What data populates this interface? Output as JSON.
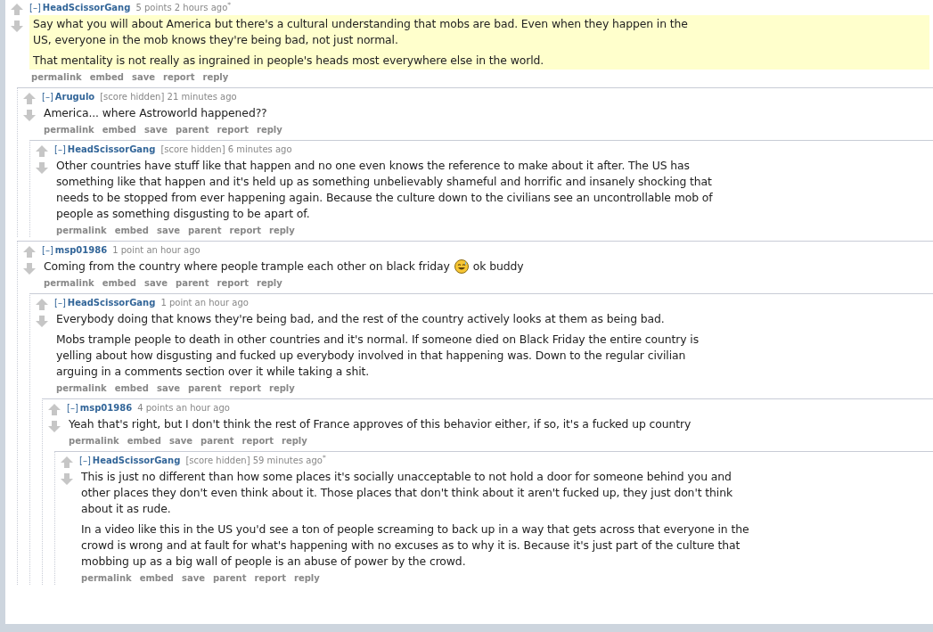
{
  "comments": [
    {
      "collapse": "[–]",
      "author": "HeadScissorGang",
      "score": "5 points",
      "time": "2 hours ago$^{*}$",
      "highlighted": true,
      "body": [
        {
          "kind": "text",
          "text": "Say what you will about America but there's a cultural understanding that mobs are bad.  Even when they happen in the US, everyone in the mob knows they're being bad, not just normal."
        },
        {
          "kind": "text",
          "text": "That mentality is not really as ingrained in people's heads most everywhere else in the world."
        }
      ],
      "buttons": [
        "permalink",
        "embed",
        "save",
        "report",
        "reply"
      ],
      "children": [
        {
          "collapse": "[–]",
          "author": "Arugulo",
          "score": "[score hidden]",
          "time": "21 minutes ago",
          "highlighted": false,
          "body": [
            {
              "kind": "text",
              "text": "America... where Astroworld happened??"
            }
          ],
          "buttons": [
            "permalink",
            "embed",
            "save",
            "parent",
            "report",
            "reply"
          ],
          "children": [
            {
              "collapse": "[–]",
              "author": "HeadScissorGang",
              "score": "[score hidden]",
              "time": "6 minutes ago",
              "highlighted": false,
              "body": [
                {
                  "kind": "text",
                  "text": "Other countries have stuff like that happen and no one even knows the reference to make about it after. The US has something like that happen and it's held up as something unbelievably shameful and horrific and insanely shocking that needs to be stopped from ever happening again. Because the culture down to the civilians see an uncontrollable mob of people as something disgusting to be apart of."
                }
              ],
              "buttons": [
                "permalink",
                "embed",
                "save",
                "parent",
                "report",
                "reply"
              ]
            }
          ]
        },
        {
          "collapse": "[–]",
          "author": "msp01986",
          "score": "1 point",
          "time": "an hour ago",
          "highlighted": false,
          "body": [
            {
              "kind": "mixed",
              "parts": [
                {
                  "kind": "text",
                  "text": "Coming from the country where people trample each other on black friday"
                },
                {
                  "kind": "emoji"
                },
                {
                  "kind": "text",
                  "text": "ok buddy"
                }
              ]
            }
          ],
          "buttons": [
            "permalink",
            "embed",
            "save",
            "parent",
            "report",
            "reply"
          ],
          "children": [
            {
              "collapse": "[–]",
              "author": "HeadScissorGang",
              "score": "1 point",
              "time": "an hour ago",
              "highlighted": false,
              "body": [
                {
                  "kind": "text",
                  "text": "Everybody doing that knows they're being bad, and the rest of the country actively looks at them as being bad."
                },
                {
                  "kind": "text",
                  "text": "Mobs trample people to death in other countries and it's normal. If someone died on Black Friday the entire country is yelling about how disgusting and fucked up everybody involved in that happening was. Down to the regular civilian arguing in a comments section over it while taking a shit."
                }
              ],
              "buttons": [
                "permalink",
                "embed",
                "save",
                "parent",
                "report",
                "reply"
              ],
              "children": [
                {
                  "collapse": "[–]",
                  "author": "msp01986",
                  "score": "4 points",
                  "time": "an hour ago",
                  "highlighted": false,
                  "body": [
                    {
                      "kind": "text",
                      "text": "Yeah that's right, but I don't think the rest of France approves of this behavior either, if so, it's a fucked up country"
                    }
                  ],
                  "buttons": [
                    "permalink",
                    "embed",
                    "save",
                    "parent",
                    "report",
                    "reply"
                  ],
                  "children": [
                    {
                      "collapse": "[–]",
                      "author": "HeadScissorGang",
                      "score": "[score hidden]",
                      "time": "59 minutes ago$^{*}$",
                      "highlighted": false,
                      "body": [
                        {
                          "kind": "text",
                          "text": "This is just no different than how some places it's socially unacceptable to not hold a door for someone behind you and other places they don't even think about it. Those places that don't think about it aren't fucked up, they just don't think about it as rude."
                        },
                        {
                          "kind": "text",
                          "text": "In a video like this in the US you'd see a ton of people screaming to back up in a way that gets across that everyone in the crowd is wrong and at fault for what's happening with no excuses as to why it is. Because it's just part of the culture that mobbing up as a big wall of people is an abuse of power by the crowd."
                        }
                      ],
                      "buttons": [
                        "permalink",
                        "embed",
                        "save",
                        "parent",
                        "report",
                        "reply"
                      ]
                    }
                  ]
                }
              ]
            }
          ]
        }
      ]
    }
  ]
}
